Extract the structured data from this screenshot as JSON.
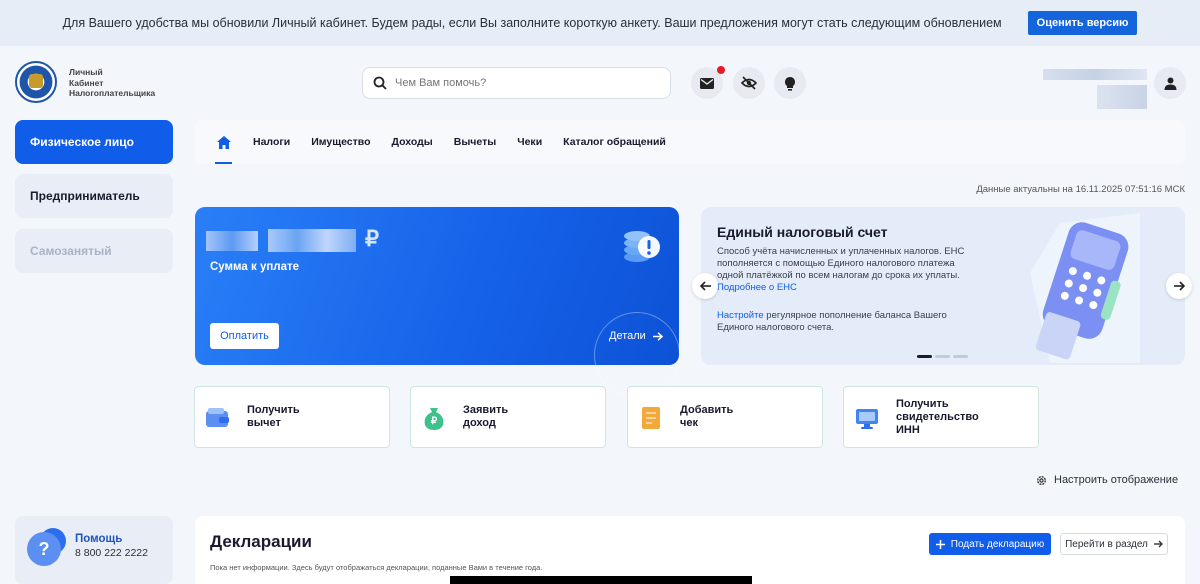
{
  "banner": {
    "text": "Для Вашего удобства мы обновили Личный кабинет. Будем рады, если Вы заполните короткую анкету. Ваши предложения могут стать следующим обновлением",
    "button": "Оценить версию"
  },
  "header": {
    "logo_lines": [
      "Личный",
      "Кабинет",
      "Налогоплательщика"
    ],
    "search_placeholder": "Чем Вам помочь?",
    "icons": [
      "mail-icon",
      "eye-off-icon",
      "lightbulb-icon",
      "user-icon"
    ],
    "mail_has_notification": true
  },
  "sidebar": {
    "items": [
      {
        "label": "Физическое лицо",
        "active": true
      },
      {
        "label": "Предприниматель",
        "active": false
      },
      {
        "label": "Самозанятый",
        "active": false,
        "disabled": true
      }
    ],
    "help": {
      "title": "Помощь",
      "phone": "8 800 222 2222"
    }
  },
  "nav": {
    "items": [
      "Налоги",
      "Имущество",
      "Доходы",
      "Вычеты",
      "Чеки",
      "Каталог обращений"
    ]
  },
  "updated": "Данные актуальны на 16.11.2025 07:51:16 МСК",
  "payment": {
    "currency": "₽",
    "label": "Сумма к уплате",
    "pay_button": "Оплатить",
    "details": "Детали"
  },
  "ens": {
    "title": "Единый налоговый счет",
    "text": "Способ учёта начисленных и уплаченных налогов. ЕНС пополняется с помощью Единого налогового платежа одной платёжкой по всем налогам до срока их уплаты.",
    "link1": "Подробнее о ЕНС",
    "link2": "Настройте",
    "text2": "регулярное пополнение баланса Вашего Единого налогового счета."
  },
  "actions": [
    {
      "label1": "Получить",
      "label2": "вычет",
      "label3": ""
    },
    {
      "label1": "Заявить",
      "label2": "доход",
      "label3": ""
    },
    {
      "label1": "Добавить",
      "label2": "чек",
      "label3": ""
    },
    {
      "label1": "Получить",
      "label2": "свидетельство",
      "label3": "ИНН"
    }
  ],
  "settings": "Настроить отображение",
  "declarations": {
    "title": "Декларации",
    "submit": "Подать декларацию",
    "goto": "Перейти в раздел",
    "note": "Пока нет информации. Здесь будут отображаться декларации, поданные Вами в течение года."
  },
  "colors": {
    "accent": "#0f5de8",
    "notification": "#e11d2a"
  }
}
